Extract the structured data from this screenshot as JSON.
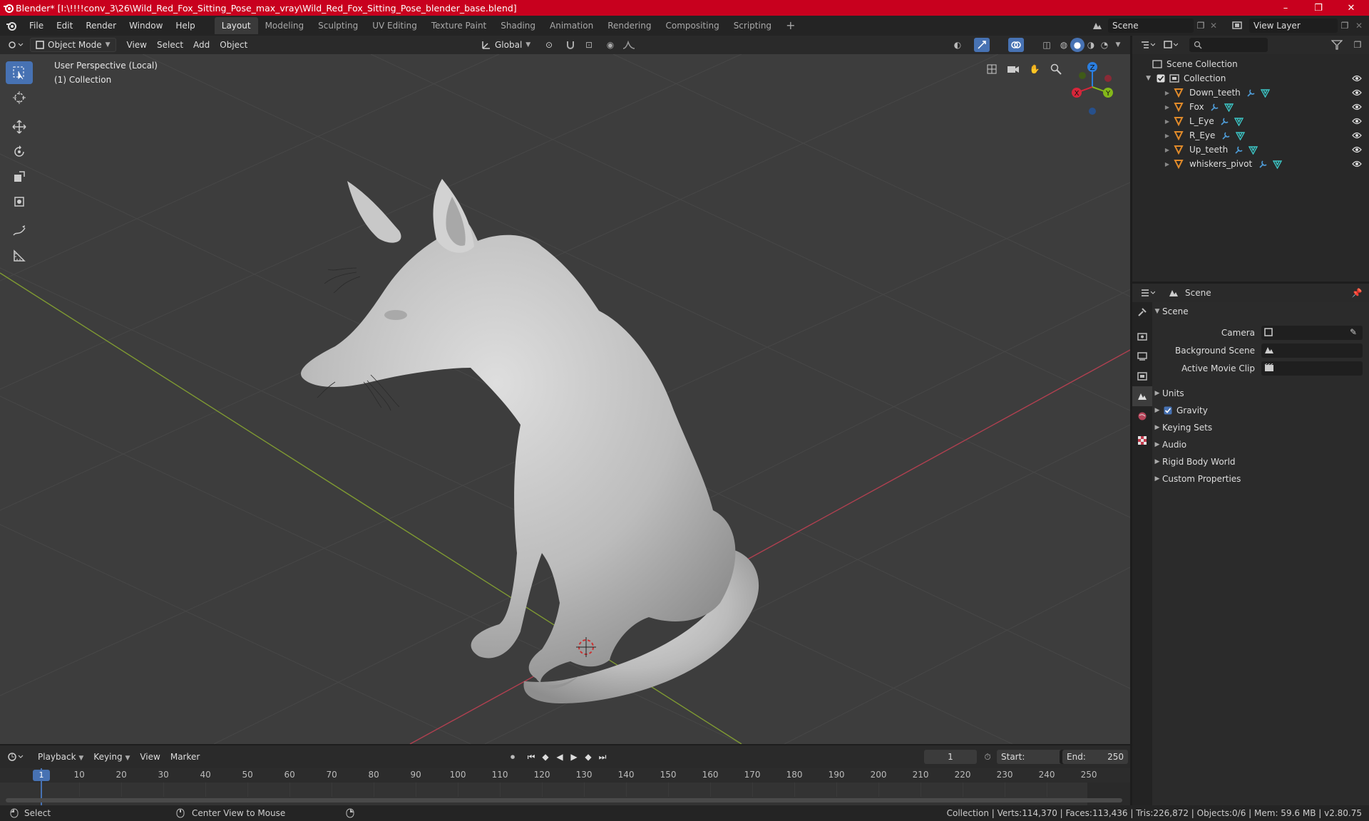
{
  "window": {
    "title": "Blender* [I:\\!!!!conv_3\\26\\Wild_Red_Fox_Sitting_Pose_max_vray\\Wild_Red_Fox_Sitting_Pose_blender_base.blend]",
    "minimize": "–",
    "maximize": "❐",
    "close": "✕"
  },
  "menu": [
    "File",
    "Edit",
    "Render",
    "Window",
    "Help"
  ],
  "workspaces": [
    "Layout",
    "Modeling",
    "Sculpting",
    "UV Editing",
    "Texture Paint",
    "Shading",
    "Animation",
    "Rendering",
    "Compositing",
    "Scripting"
  ],
  "active_workspace": "Layout",
  "add_workspace": "+",
  "scene_selector": "Scene",
  "view_layer": "View Layer",
  "viewport": {
    "mode": "Object Mode",
    "menus": [
      "View",
      "Select",
      "Add",
      "Object"
    ],
    "transform_orientation": "Global",
    "perspective_label": "User Perspective (Local)",
    "collection_label": "(1) Collection",
    "gizmo_axes": {
      "x": "X",
      "y": "Y",
      "z": "Z"
    }
  },
  "tools": [
    "select-box-icon",
    "cursor-icon",
    "move-icon",
    "rotate-icon",
    "scale-icon",
    "transform-icon",
    "annotate-icon",
    "measure-icon"
  ],
  "outliner": {
    "root": "Scene Collection",
    "collection": "Collection",
    "objects": [
      "Down_teeth",
      "Fox",
      "L_Eye",
      "R_Eye",
      "Up_teeth",
      "whiskers_pivot"
    ]
  },
  "properties": {
    "context": "Scene",
    "panel_title": "Scene",
    "camera_label": "Camera",
    "background_scene_label": "Background Scene",
    "active_movie_clip_label": "Active Movie Clip",
    "sections": [
      "Units",
      "Gravity",
      "Keying Sets",
      "Audio",
      "Rigid Body World",
      "Custom Properties"
    ],
    "gravity_checked": true
  },
  "timeline": {
    "menus": [
      "Playback",
      "Keying",
      "View",
      "Marker"
    ],
    "current_frame": "1",
    "start_label": "Start:",
    "start": "1",
    "end_label": "End:",
    "end": "250",
    "ruler": [
      "1",
      "10",
      "20",
      "30",
      "40",
      "50",
      "60",
      "70",
      "80",
      "90",
      "100",
      "110",
      "120",
      "130",
      "140",
      "150",
      "160",
      "170",
      "180",
      "190",
      "200",
      "210",
      "220",
      "230",
      "240",
      "250"
    ]
  },
  "status": {
    "left": "Select",
    "middle": "Center View to Mouse",
    "right": "Collection | Verts:114,370 | Faces:113,436 | Tris:226,872 | Objects:0/6 | Mem: 59.6 MB | v2.80.75"
  },
  "colors": {
    "titlebar": "#c8001e",
    "accent": "#4772b3",
    "x_axis": "#d6263a",
    "y_axis": "#84b81a",
    "z_axis": "#2a7ee0"
  }
}
